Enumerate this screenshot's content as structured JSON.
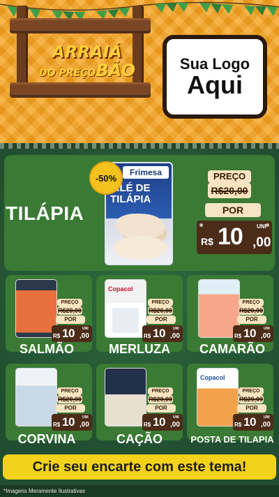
{
  "header": {
    "festival_title_line1": "ARRAIÁ",
    "festival_title_line2_small": "DO PREÇO",
    "festival_title_line2_big": "BÃO",
    "logo_line1": "Sua Logo",
    "logo_line2": "Aqui"
  },
  "featured": {
    "name": "TILÁPIA",
    "discount_badge": "-50%",
    "package_brand": "Frimesa",
    "package_product": "FILÉ DE TILÁPIA",
    "price_label": "PREÇO",
    "old_price": "R$20,00",
    "por_label": "POR",
    "currency": "R$",
    "new_price_int": "10",
    "new_price_cents": ",00",
    "unit": "UNI"
  },
  "products": [
    {
      "name": "SALMÃO",
      "price_label": "PREÇO",
      "old_price": "R$20,00",
      "por_label": "POR",
      "currency": "R$",
      "new_price_int": "10",
      "new_price_cents": ",00",
      "unit": "UNI"
    },
    {
      "name": "MERLUZA",
      "price_label": "PREÇO",
      "old_price": "R$20,00",
      "por_label": "POR",
      "currency": "R$",
      "new_price_int": "10",
      "new_price_cents": ",00",
      "unit": "UNI",
      "package_brand": "Copacol"
    },
    {
      "name": "CAMARÃO",
      "price_label": "PREÇO",
      "old_price": "R$20,00",
      "por_label": "POR",
      "currency": "R$",
      "new_price_int": "10",
      "new_price_cents": ",00",
      "unit": "UNI"
    },
    {
      "name": "CORVINA",
      "price_label": "PREÇO",
      "old_price": "R$20,00",
      "por_label": "POR",
      "currency": "R$",
      "new_price_int": "10",
      "new_price_cents": ",00",
      "unit": "UNI"
    },
    {
      "name": "CAÇÃO",
      "price_label": "PREÇO",
      "old_price": "R$20,00",
      "por_label": "POR",
      "currency": "R$",
      "new_price_int": "10",
      "new_price_cents": ",00",
      "unit": "UNI"
    },
    {
      "name": "POSTA DE TILAPIA",
      "price_label": "PREÇO",
      "old_price": "R$20,00",
      "por_label": "POR",
      "currency": "R$",
      "new_price_int": "10",
      "new_price_cents": ",00",
      "unit": "UNI",
      "package_brand": "Copacol"
    }
  ],
  "footer": {
    "cta": "Crie seu encarte com este tema!",
    "disclaimer": "*Imagens Meramente Ilustrativas"
  },
  "colors": {
    "header_orange": "#f4a21e",
    "board_green": "#214e30",
    "card_green": "#3a7a34",
    "price_cream": "#f7e4c2",
    "price_brown": "#4b2c18",
    "cta_yellow": "#f2d21a"
  },
  "icons": [
    "bunting-flags-icon",
    "wooden-sign-icon",
    "fish-package-icon"
  ]
}
